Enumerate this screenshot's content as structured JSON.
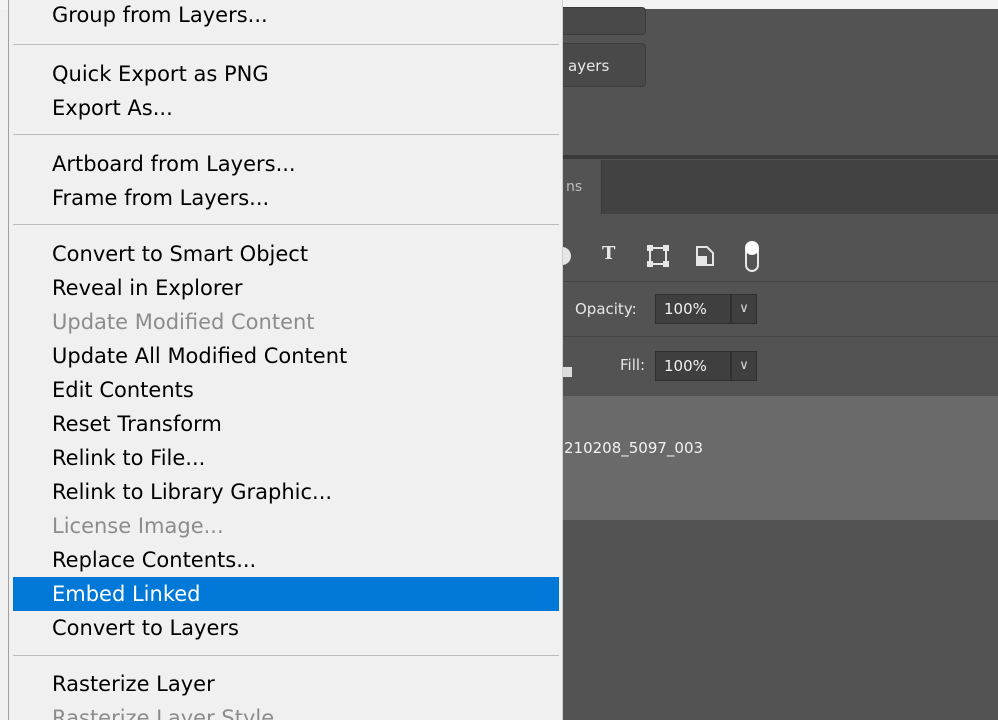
{
  "ps_panel": {
    "btn1_label": "",
    "btn2_label": "ayers",
    "tab_label": "ns",
    "toolbar_icons": [
      "circle-icon",
      "type-icon",
      "transform-icon",
      "smart-object-icon",
      "toggle-icon"
    ],
    "opacity_label": "Opacity:",
    "opacity_value": "100%",
    "fill_label": "Fill:",
    "fill_value": "100%",
    "layer_name": "210208_5097_003"
  },
  "menu": {
    "items": [
      {
        "label": "Group from Layers...",
        "state": "normal"
      },
      {
        "label": "Quick Export as PNG",
        "state": "normal"
      },
      {
        "label": "Export As...",
        "state": "normal"
      },
      {
        "label": "Artboard from Layers...",
        "state": "normal"
      },
      {
        "label": "Frame from Layers...",
        "state": "normal"
      },
      {
        "label": "Convert to Smart Object",
        "state": "normal"
      },
      {
        "label": "Reveal in Explorer",
        "state": "normal"
      },
      {
        "label": "Update Modified Content",
        "state": "disabled"
      },
      {
        "label": "Update All Modified Content",
        "state": "normal"
      },
      {
        "label": "Edit Contents",
        "state": "normal"
      },
      {
        "label": "Reset Transform",
        "state": "normal"
      },
      {
        "label": "Relink to File...",
        "state": "normal"
      },
      {
        "label": "Relink to Library Graphic...",
        "state": "normal"
      },
      {
        "label": "License Image...",
        "state": "disabled"
      },
      {
        "label": "Replace Contents...",
        "state": "normal"
      },
      {
        "label": "Embed Linked",
        "state": "highlighted"
      },
      {
        "label": "Convert to Layers",
        "state": "normal"
      },
      {
        "label": "Rasterize Layer",
        "state": "normal"
      },
      {
        "label": "Rasterize Layer Style",
        "state": "disabled"
      }
    ]
  },
  "colors": {
    "highlight": "#0078d7",
    "menu_bg": "#f0f0f0",
    "panel_bg": "#535353",
    "disabled_text": "#8c8c8c"
  }
}
